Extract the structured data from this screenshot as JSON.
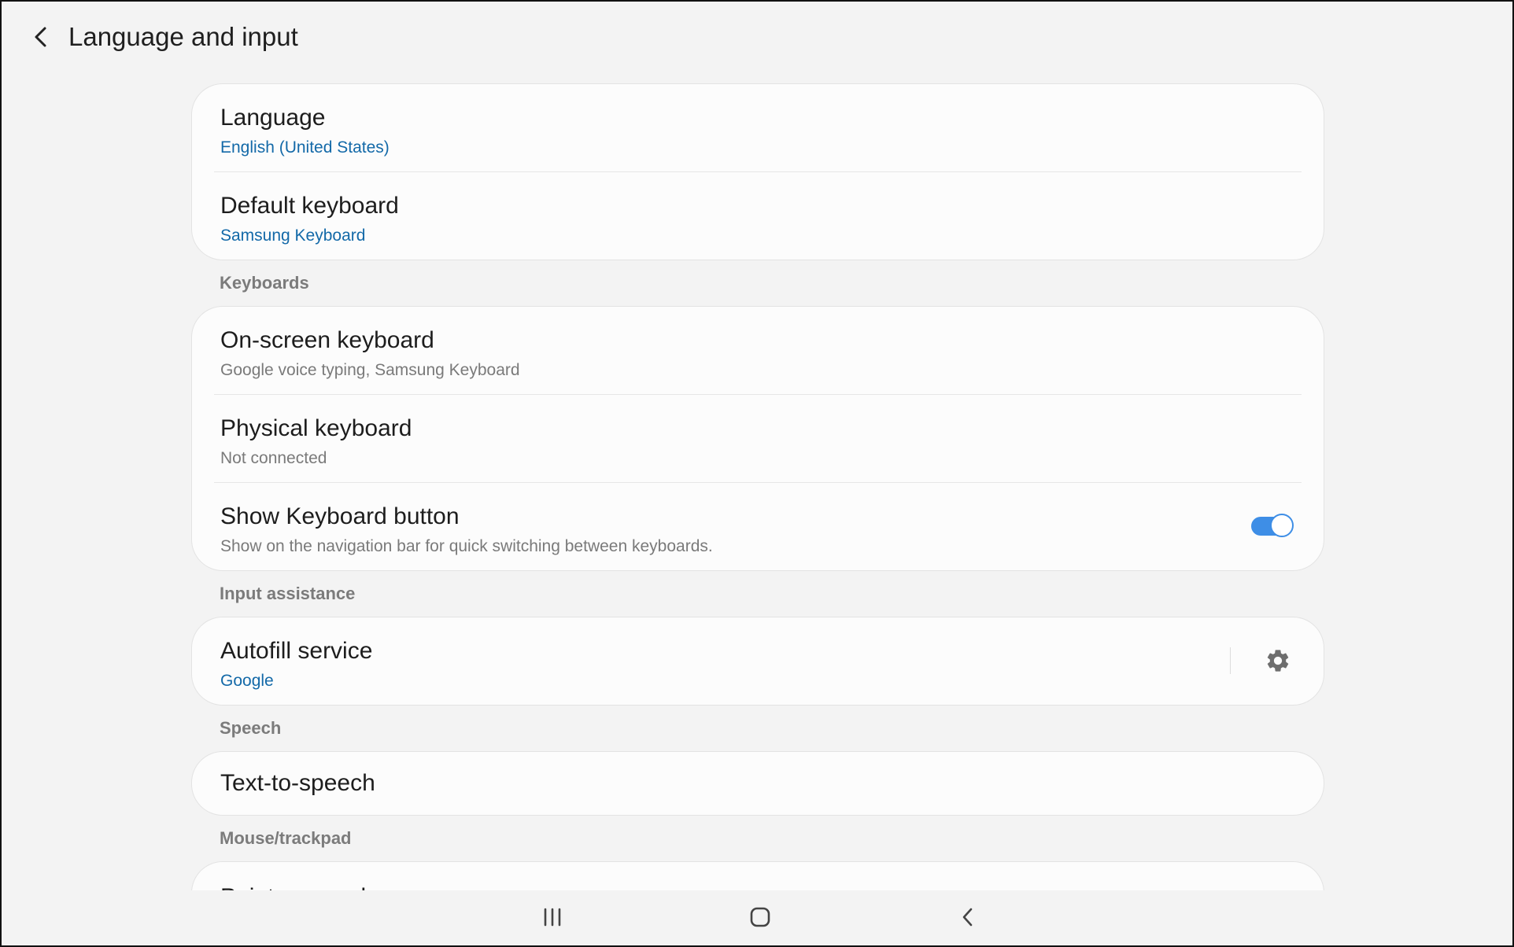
{
  "header": {
    "title": "Language and input",
    "back_icon": "chevron-left-icon"
  },
  "group_general": {
    "items": [
      {
        "title": "Language",
        "summary": "English (United States)"
      },
      {
        "title": "Default keyboard",
        "summary": "Samsung Keyboard"
      }
    ]
  },
  "sections": {
    "keyboards": "Keyboards",
    "input_assistance": "Input assistance",
    "speech": "Speech",
    "mouse_trackpad": "Mouse/trackpad"
  },
  "group_keyboards": {
    "items": [
      {
        "title": "On-screen keyboard",
        "summary": "Google voice typing, Samsung Keyboard"
      },
      {
        "title": "Physical keyboard",
        "summary": "Not connected"
      },
      {
        "title": "Show Keyboard button",
        "summary": "Show on the navigation bar for quick switching between keyboards.",
        "toggle_on": true
      }
    ]
  },
  "group_input_assistance": {
    "items": [
      {
        "title": "Autofill service",
        "summary": "Google",
        "settings_icon": "gear-icon"
      }
    ]
  },
  "group_speech": {
    "items": [
      {
        "title": "Text-to-speech"
      }
    ]
  },
  "group_mouse": {
    "items": [
      {
        "title": "Pointer speed"
      }
    ]
  },
  "navbar": {
    "recents_icon": "recents-icon",
    "home_icon": "home-icon",
    "back_icon": "back-icon"
  },
  "colors": {
    "accent": "#3e8ee6",
    "summary_link": "#1369a8",
    "background": "#f3f3f3",
    "card": "#fcfcfc"
  }
}
